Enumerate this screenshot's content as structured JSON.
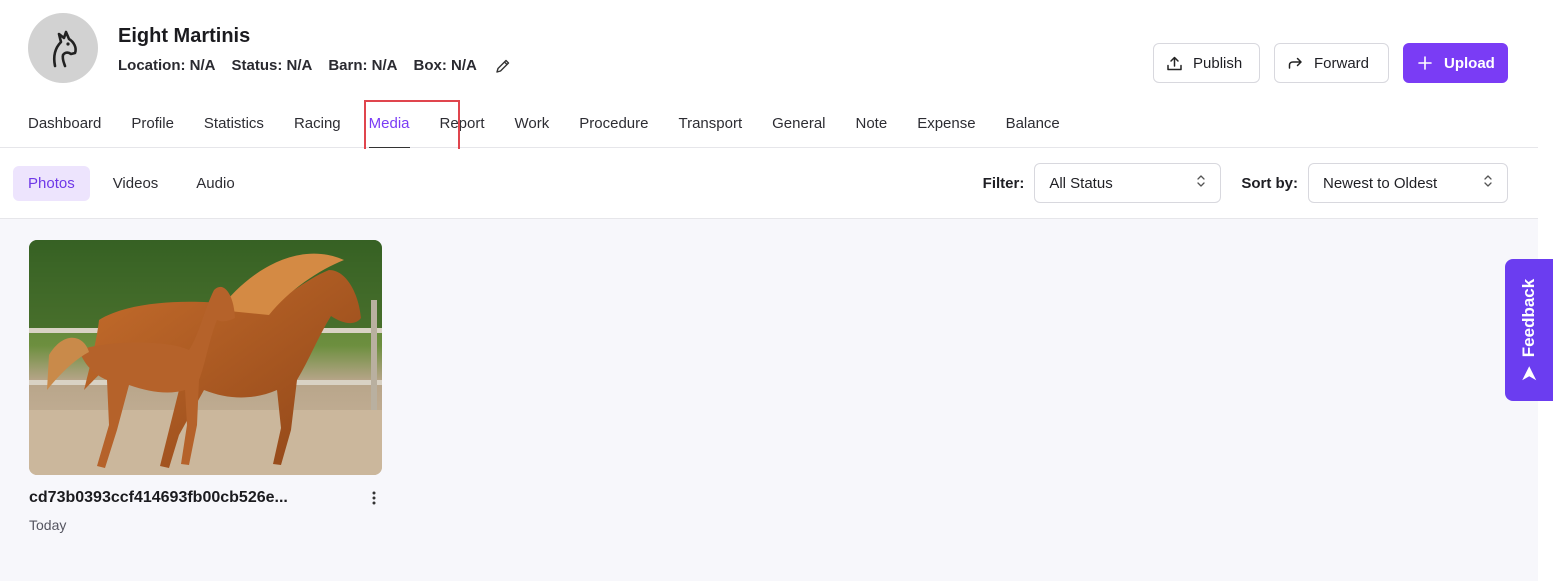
{
  "horse": {
    "name": "Eight Martinis",
    "location": "Location: N/A",
    "status": "Status: N/A",
    "barn": "Barn: N/A",
    "box": "Box: N/A",
    "avatar_icon": "horse-head-icon"
  },
  "actions": {
    "publish": "Publish",
    "forward": "Forward",
    "upload": "Upload",
    "accent": "#7a3cf5"
  },
  "tabs": [
    {
      "label": "Dashboard"
    },
    {
      "label": "Profile"
    },
    {
      "label": "Statistics"
    },
    {
      "label": "Racing"
    },
    {
      "label": "Media",
      "active": true
    },
    {
      "label": "Report"
    },
    {
      "label": "Work"
    },
    {
      "label": "Procedure"
    },
    {
      "label": "Transport"
    },
    {
      "label": "General"
    },
    {
      "label": "Note"
    },
    {
      "label": "Expense"
    },
    {
      "label": "Balance"
    }
  ],
  "media_tabs": [
    {
      "label": "Photos",
      "active": true
    },
    {
      "label": "Videos"
    },
    {
      "label": "Audio"
    }
  ],
  "filters": {
    "filter_label": "Filter:",
    "filter_value": "All Status",
    "sort_label": "Sort by:",
    "sort_value": "Newest to Oldest"
  },
  "media_items": [
    {
      "title": "cd73b0393ccf414693fb00cb526e...",
      "date": "Today",
      "image": "mare-and-foal-running-photo"
    }
  ],
  "feedback": {
    "label": "Feedback",
    "color": "#6b3df0"
  }
}
